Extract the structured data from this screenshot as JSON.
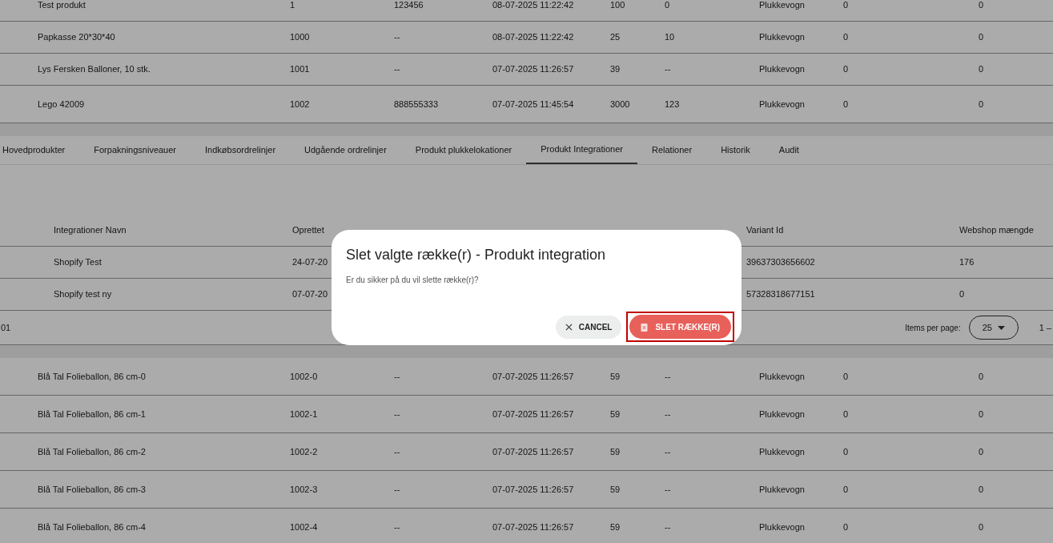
{
  "products_table": {
    "rows": [
      {
        "cells": [
          "Test produkt",
          "1",
          "123456",
          "08-07-2025 11:22:42",
          "100",
          "0",
          "Plukkevogn",
          "0",
          "0"
        ]
      },
      {
        "cells": [
          "Papkasse 20*30*40",
          "1000",
          "--",
          "08-07-2025 11:22:42",
          "25",
          "10",
          "Plukkevogn",
          "0",
          "0"
        ]
      },
      {
        "cells": [
          "Lys Fersken Balloner, 10 stk.",
          "1001",
          "--",
          "07-07-2025 11:26:57",
          "39",
          "--",
          "Plukkevogn",
          "0",
          "0"
        ]
      },
      {
        "cells": [
          "Lego 42009",
          "1002",
          "888555333",
          "07-07-2025 11:45:54",
          "3000",
          "123",
          "Plukkevogn",
          "0",
          "0"
        ]
      }
    ]
  },
  "tabs": [
    {
      "label": "Hovedprodukter",
      "selected": false
    },
    {
      "label": "Forpakningsniveauer",
      "selected": false
    },
    {
      "label": "Indkøbsordrelinjer",
      "selected": false
    },
    {
      "label": "Udgående ordrelinjer",
      "selected": false
    },
    {
      "label": "Produkt plukkelokationer",
      "selected": false
    },
    {
      "label": "Produkt Integrationer",
      "selected": true
    },
    {
      "label": "Relationer",
      "selected": false
    },
    {
      "label": "Historik",
      "selected": false
    },
    {
      "label": "Audit",
      "selected": false
    }
  ],
  "integrations_table": {
    "columns": [
      "Integrationer Navn",
      "Oprettet",
      "Variant Id",
      "Webshop mængde"
    ],
    "rows": [
      {
        "cells": [
          "Shopify Test",
          "24-07-20",
          "39637303656602",
          "176"
        ]
      },
      {
        "cells": [
          "Shopify test ny",
          "07-07-20",
          "57328318677151",
          "0"
        ]
      }
    ],
    "paginator": {
      "left_text": "01",
      "items_per_page_label": "Items per page:",
      "items_per_page": "25",
      "range": "1 –"
    }
  },
  "variants_table": {
    "rows": [
      {
        "cells": [
          "Blå Tal Folieballon, 86 cm-0",
          "1002-0",
          "--",
          "07-07-2025 11:26:57",
          "59",
          "--",
          "Plukkevogn",
          "0",
          "0"
        ]
      },
      {
        "cells": [
          "Blå Tal Folieballon, 86 cm-1",
          "1002-1",
          "--",
          "07-07-2025 11:26:57",
          "59",
          "--",
          "Plukkevogn",
          "0",
          "0"
        ]
      },
      {
        "cells": [
          "Blå Tal Folieballon, 86 cm-2",
          "1002-2",
          "--",
          "07-07-2025 11:26:57",
          "59",
          "--",
          "Plukkevogn",
          "0",
          "0"
        ]
      },
      {
        "cells": [
          "Blå Tal Folieballon, 86 cm-3",
          "1002-3",
          "--",
          "07-07-2025 11:26:57",
          "59",
          "--",
          "Plukkevogn",
          "0",
          "0"
        ]
      },
      {
        "cells": [
          "Blå Tal Folieballon, 86 cm-4",
          "1002-4",
          "--",
          "07-07-2025 11:26:57",
          "59",
          "--",
          "Plukkevogn",
          "0",
          "0"
        ]
      }
    ]
  },
  "dialog": {
    "title": "Slet valgte række(r) - Produkt integration",
    "message": "Er du sikker på du vil slette række(r)?",
    "cancel_label": "CANCEL",
    "confirm_label": "SLET RÆKKE(R)"
  }
}
